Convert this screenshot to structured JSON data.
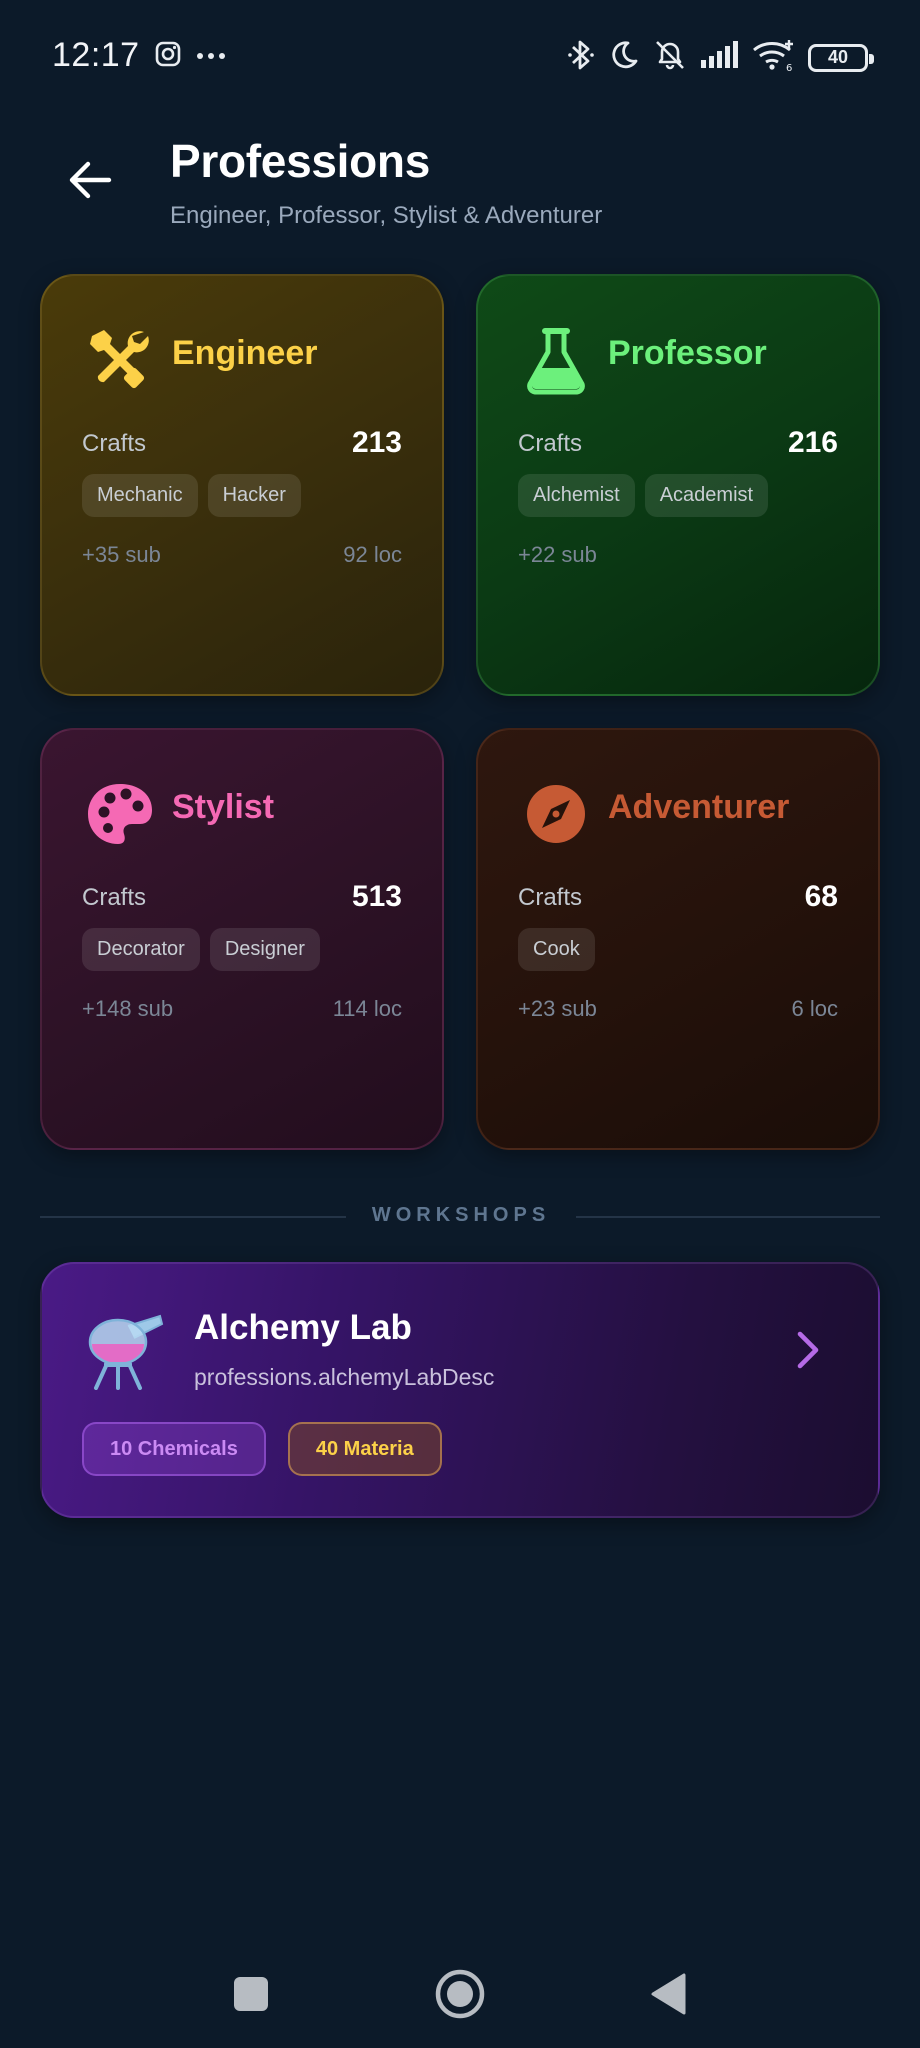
{
  "status_bar": {
    "time": "12:17",
    "battery": "40"
  },
  "header": {
    "title": "Professions",
    "subtitle": "Engineer, Professor, Stylist & Adventurer"
  },
  "professions": [
    {
      "name": "Engineer",
      "icon": "tools-icon",
      "color": "#fcd148",
      "crafts_label": "Crafts",
      "crafts": "213",
      "tags": [
        "Mechanic",
        "Hacker"
      ],
      "sub": "+35 sub",
      "loc": "92 loc"
    },
    {
      "name": "Professor",
      "icon": "flask-icon",
      "color": "#6cf07c",
      "crafts_label": "Crafts",
      "crafts": "216",
      "tags": [
        "Alchemist",
        "Academist"
      ],
      "sub": "+22 sub",
      "loc": ""
    },
    {
      "name": "Stylist",
      "icon": "palette-icon",
      "color": "#f569b4",
      "crafts_label": "Crafts",
      "crafts": "513",
      "tags": [
        "Decorator",
        "Designer"
      ],
      "sub": "+148 sub",
      "loc": "114 loc"
    },
    {
      "name": "Adventurer",
      "icon": "compass-icon",
      "color": "#c65a34",
      "crafts_label": "Crafts",
      "crafts": "68",
      "tags": [
        "Cook"
      ],
      "sub": "+23 sub",
      "loc": "6 loc"
    }
  ],
  "workshops": {
    "section_label": "WORKSHOPS",
    "items": [
      {
        "title": "Alchemy Lab",
        "description": "professions.alchemyLabDesc",
        "icon": "alembic-icon",
        "badges": [
          "10 Chemicals",
          "40 Materia"
        ]
      }
    ]
  }
}
